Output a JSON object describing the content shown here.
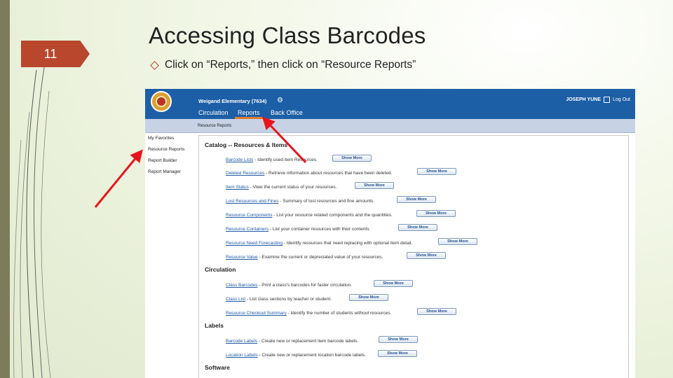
{
  "slide": {
    "number": "11",
    "title": "Accessing Class Barcodes",
    "bullet": "Click on “Reports,” then click on “Resource Reports”"
  },
  "app": {
    "school": "Weigand Elementary (7634)",
    "tabs": [
      "Circulation",
      "Reports",
      "Back Office"
    ],
    "active_tab": "Reports",
    "user": "JOSEPH YUNE",
    "logout": "Log Out",
    "breadcrumb": "Resource Reports",
    "sidebar": [
      "My Favorites",
      "Resource Reports",
      "Report Builder",
      "Report Manager"
    ],
    "show_more": "Show More",
    "sections": [
      {
        "title": "Catalog -- Resources & Items",
        "items": [
          {
            "name": "Barcode Lists",
            "desc": " - Identify used item Resources."
          },
          {
            "name": "Deleted Resources",
            "desc": " - Retrieve information about resources that have been deleted."
          },
          {
            "name": "Item Status",
            "desc": " - View the current status of your resources."
          },
          {
            "name": "Lost Resources and Fines",
            "desc": " - Summary of lost resources and fine amounts."
          },
          {
            "name": "Resource Components",
            "desc": " - List your resource related components and the quantities."
          },
          {
            "name": "Resource Containers",
            "desc": " - List your container resources with their contents."
          },
          {
            "name": "Resource Need Forecasting",
            "desc": " - Identify resources that need replacing with optional item detail."
          },
          {
            "name": "Resource Value",
            "desc": " - Examine the current or depreciated value of your resources."
          }
        ]
      },
      {
        "title": "Circulation",
        "items": [
          {
            "name": "Class Barcodes",
            "desc": " - Print a class's barcodes for faster circulation."
          },
          {
            "name": "Class List",
            "desc": " - List class sections by teacher or student."
          },
          {
            "name": "Resource Checkout Summary",
            "desc": " - Identify the number of students without resources."
          }
        ]
      },
      {
        "title": "Labels",
        "items": [
          {
            "name": "Barcode Labels",
            "desc": " - Create new or replacement item barcode labels."
          },
          {
            "name": "Location Labels",
            "desc": " - Create new or replacement location barcode labels."
          }
        ]
      },
      {
        "title": "Software",
        "items": []
      }
    ]
  },
  "colors": {
    "accent": "#b9472d",
    "topbar": "#1d5fa6",
    "annotation_arrow": "#e8141c"
  },
  "icons": [
    "diamond-bullet-icon",
    "gear-icon",
    "logout-icon",
    "school-logo"
  ]
}
